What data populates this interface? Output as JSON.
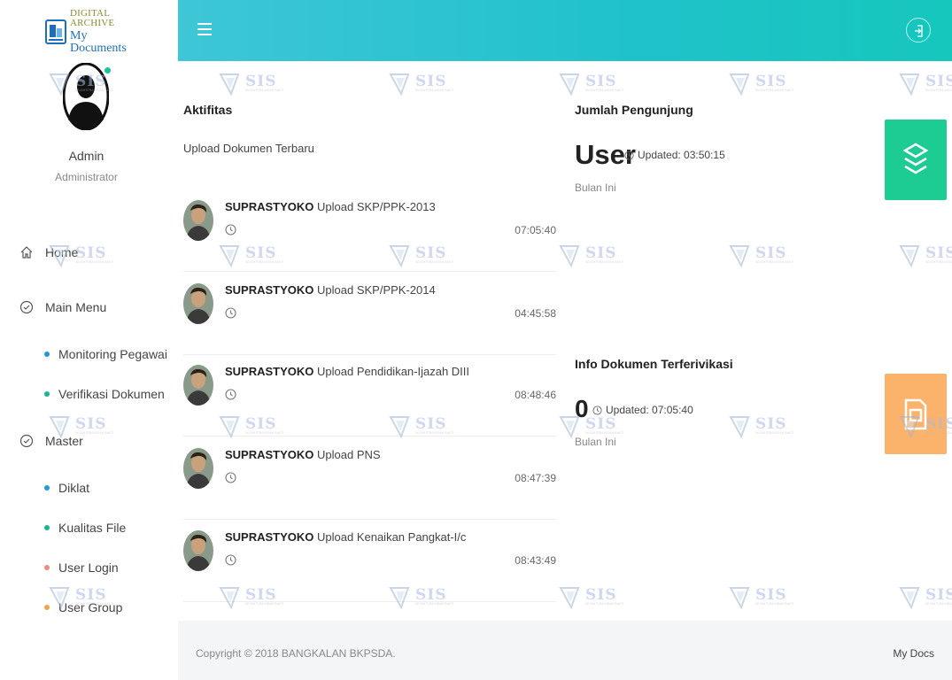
{
  "app": {
    "logo_line1": "DIGITAL ARCHIVE",
    "logo_line2": "My Documents"
  },
  "user": {
    "name": "Admin",
    "role": "Administrator",
    "status_color": "#16c39a"
  },
  "sidebar": {
    "home": "Home",
    "main_menu": "Main Menu",
    "main_items": [
      {
        "label": "Monitoring Pegawai",
        "dot": "#1e9bd7"
      },
      {
        "label": "Verifikasi Dokumen",
        "dot": "#17b890"
      }
    ],
    "master": "Master",
    "master_items": [
      {
        "label": "Diklat",
        "dot": "#1e9bd7"
      },
      {
        "label": "Kualitas File",
        "dot": "#17b890"
      },
      {
        "label": "User Login",
        "dot": "#f08b7a"
      },
      {
        "label": "User Group",
        "dot": "#f5a24b"
      }
    ]
  },
  "activity": {
    "title": "Aktifitas",
    "subtitle": "Upload Dokumen Terbaru",
    "items": [
      {
        "user": "SUPRASTYOKO",
        "action": " Upload SKP/PPK-2013",
        "time": "07:05:40"
      },
      {
        "user": "SUPRASTYOKO",
        "action": " Upload SKP/PPK-2014",
        "time": "04:45:58"
      },
      {
        "user": "SUPRASTYOKO",
        "action": " Upload Pendidikan-Ijazah DIII",
        "time": "08:48:46"
      },
      {
        "user": "SUPRASTYOKO",
        "action": " Upload PNS",
        "time": "08:47:39"
      },
      {
        "user": "SUPRASTYOKO",
        "action": " Upload Kenaikan Pangkat-I/c",
        "time": "08:43:49"
      }
    ]
  },
  "visitors": {
    "title": "Jumlah Pengunjung",
    "value": "User",
    "updated": "Updated: 03:50:15",
    "period": "Bulan Ini"
  },
  "verified": {
    "title": "Info Dokumen Terferivikasi",
    "value": "0",
    "updated": "Updated: 07:05:40",
    "period": "Bulan Ini"
  },
  "footer": {
    "copyright": "Copyright © 2018 BANGKALAN BKPSDA.",
    "brand": "My Docs"
  },
  "watermark": {
    "text": "SIS",
    "tagline": "SEJAHTERA INDAH BAKTI"
  },
  "colors": {
    "topbar": "#1fc2c9",
    "tile_green": "#1dcc93",
    "tile_orange": "#fbb36b"
  }
}
